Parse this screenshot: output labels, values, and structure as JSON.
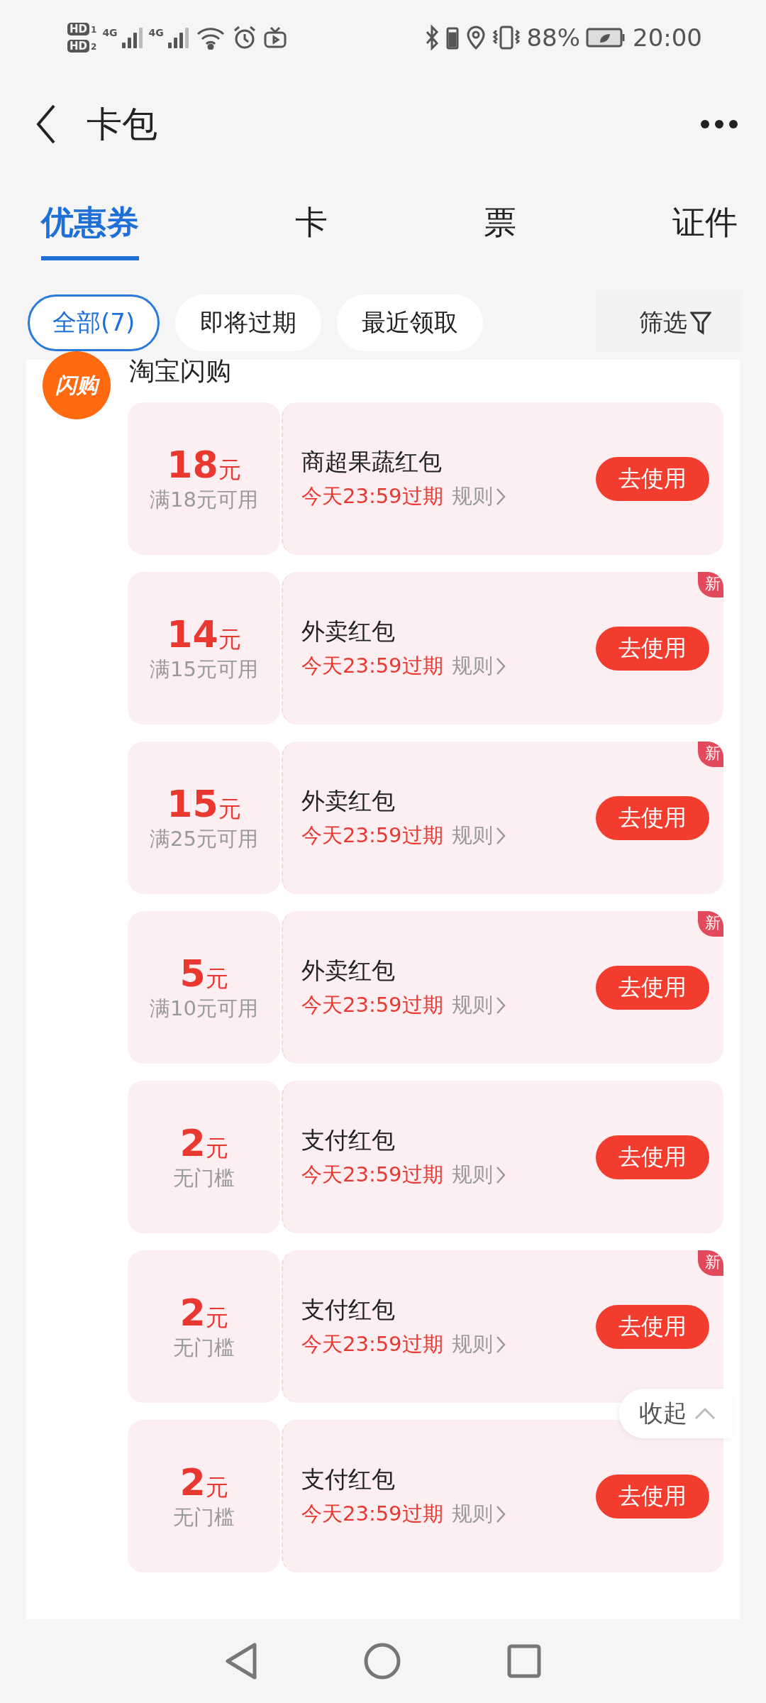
{
  "status_bar": {
    "sims": [
      {
        "label": "HD",
        "slot": "1"
      },
      {
        "label": "HD",
        "slot": "2"
      }
    ],
    "networks": [
      "4G",
      "4G"
    ],
    "battery_percent": "88%",
    "time": "20:00"
  },
  "header": {
    "title": "卡包"
  },
  "tabs": [
    {
      "label": "优惠券",
      "selected": true
    },
    {
      "label": "卡",
      "selected": false
    },
    {
      "label": "票",
      "selected": false
    },
    {
      "label": "证件",
      "selected": false
    }
  ],
  "filters": [
    {
      "label": "全部(7)",
      "selected": true
    },
    {
      "label": "即将过期",
      "selected": false
    },
    {
      "label": "最近领取",
      "selected": false
    }
  ],
  "filter_button": "筛选",
  "merchant": {
    "logo_text": "闪购",
    "name": "淘宝闪购"
  },
  "coupons": [
    {
      "amount": "18",
      "unit": "元",
      "condition": "满18元可用",
      "title": "商超果蔬红包",
      "expiry": "今天23:59过期",
      "rules": "规则",
      "button": "去使用"
    },
    {
      "amount": "14",
      "unit": "元",
      "condition": "满15元可用",
      "title": "外卖红包",
      "expiry": "今天23:59过期",
      "rules": "规则",
      "button": "去使用",
      "badge": "新"
    },
    {
      "amount": "15",
      "unit": "元",
      "condition": "满25元可用",
      "title": "外卖红包",
      "expiry": "今天23:59过期",
      "rules": "规则",
      "button": "去使用",
      "badge": "新"
    },
    {
      "amount": "5",
      "unit": "元",
      "condition": "满10元可用",
      "title": "外卖红包",
      "expiry": "今天23:59过期",
      "rules": "规则",
      "button": "去使用",
      "badge": "新"
    },
    {
      "amount": "2",
      "unit": "元",
      "condition": "无门槛",
      "title": "支付红包",
      "expiry": "今天23:59过期",
      "rules": "规则",
      "button": "去使用"
    },
    {
      "amount": "2",
      "unit": "元",
      "condition": "无门槛",
      "title": "支付红包",
      "expiry": "今天23:59过期",
      "rules": "规则",
      "button": "去使用",
      "badge": "新"
    },
    {
      "amount": "2",
      "unit": "元",
      "condition": "无门槛",
      "title": "支付红包",
      "expiry": "今天23:59过期",
      "rules": "规则",
      "button": "去使用"
    }
  ],
  "collapse_button": "收起"
}
